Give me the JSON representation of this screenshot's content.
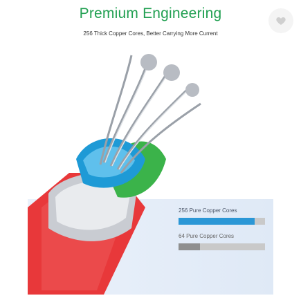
{
  "header": {
    "title": "Premium Engineering",
    "subtitle": "256 Thick Copper Cores, Better Carrying More Current"
  },
  "favorite": {
    "icon": "heart-icon"
  },
  "stats": [
    {
      "label": "256 Pure Copper Cores",
      "fill": 0.88,
      "color": "#2b97d6"
    },
    {
      "label": "64 Pure Copper Cores",
      "fill": 0.25,
      "color": "#8f8f8f"
    }
  ],
  "colors": {
    "title": "#22a052",
    "cable_jacket": "#e8383a",
    "inner_insulation": "#1e9ad6"
  }
}
